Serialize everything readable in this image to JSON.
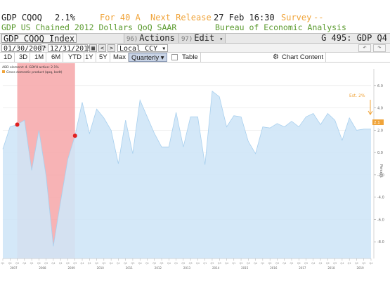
{
  "info_line": {
    "ticker": "GDP CQOQ",
    "value": "2.1%",
    "for_label": "For 40 A",
    "next_release_label": "Next Release",
    "next_release_value": "27 Feb 16:30",
    "survey_label": "Survey",
    "survey_value": "--"
  },
  "subtitle": {
    "description": "GDP US Chained 2012 Dollars QoQ SAAR",
    "source": "Bureau of Economic Analysis"
  },
  "title_bar": {
    "title": "GDP CQOQ Index",
    "actions_num": "96)",
    "actions_label": "Actions",
    "edit_num": "97)",
    "edit_label": "Edit",
    "right_info": "G 495: GDP Q4"
  },
  "date_range": {
    "start": "01/30/2007",
    "end": "12/31/2019",
    "currency": "Local CCY",
    "prev_symbol": "<",
    "next_symbol": ">",
    "undo_icon": "undo-icon",
    "redo_icon": "redo-icon"
  },
  "period_buttons": [
    "1D",
    "3D",
    "1M",
    "6M",
    "YTD",
    "1Y",
    "5Y",
    "Max"
  ],
  "frequency": "Quarterly",
  "table_label": "Table",
  "chart_content_label": "Chart Content",
  "chart_data": {
    "type": "area",
    "legend_header": "ABD element: 4. GDYH active: 2.1%",
    "legend_item": "Gross domestic product (qoq, bsdt)",
    "ylabel": "Percent",
    "annotation": "Est. 2%",
    "last_value_label": "2.1",
    "ylim": [
      -9.5,
      7.5
    ],
    "yticks": [
      6,
      4,
      2,
      0,
      -2,
      -4,
      -6,
      -8
    ],
    "years": [
      "2007",
      "2008",
      "2009",
      "2010",
      "2011",
      "2012",
      "2013",
      "2014",
      "2015",
      "2016",
      "2017",
      "2018",
      "2019"
    ],
    "recession": {
      "start_index": 2,
      "end_index": 10
    },
    "values": [
      0.3,
      2.3,
      2.5,
      2.9,
      -1.6,
      2.0,
      -2.1,
      -8.4,
      -4.4,
      -0.6,
      1.5,
      4.5,
      1.7,
      3.9,
      3.1,
      2.0,
      -1.0,
      2.9,
      -0.1,
      4.7,
      3.2,
      1.7,
      0.5,
      0.5,
      3.6,
      0.5,
      3.2,
      3.2,
      -1.1,
      5.5,
      5.0,
      2.3,
      3.3,
      3.2,
      1.0,
      -0.1,
      2.3,
      2.2,
      2.6,
      2.3,
      2.8,
      2.3,
      3.2,
      3.5,
      2.5,
      3.5,
      2.9,
      1.1,
      3.1,
      2.0,
      2.1,
      2.1
    ],
    "series_color": "#cfe6f7",
    "line_color": "#a9d0ee",
    "recession_color": "#f6a6a8",
    "marker_color": "#e02020",
    "annotation_color": "#f0a43a"
  }
}
